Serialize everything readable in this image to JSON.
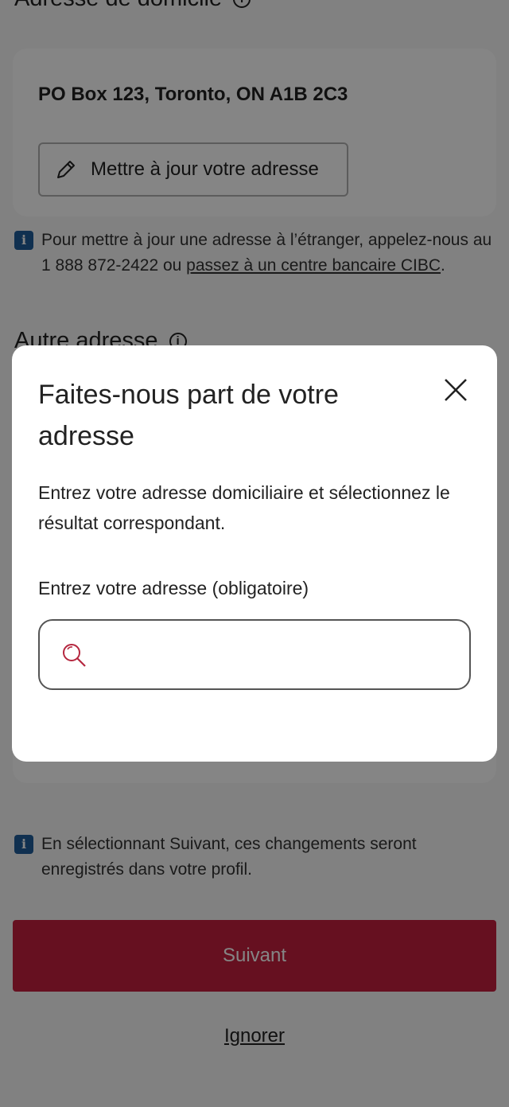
{
  "home_address": {
    "heading": "Adresse de domicile",
    "address": "PO Box 123, Toronto, ON A1B 2C3",
    "update_button": "Mettre à jour votre adresse"
  },
  "foreign_note": {
    "text": "Pour mettre à jour une adresse à l’étranger, appelez-nous au 1 888 872-2422 ou ",
    "link": "passez à un centre bancaire CIBC",
    "suffix": "."
  },
  "other_address": {
    "heading": "Autre adresse"
  },
  "save_note": {
    "text": "En sélectionnant Suivant, ces changements seront enregistrés dans votre profil."
  },
  "actions": {
    "next": "Suivant",
    "skip": "Ignorer"
  },
  "modal": {
    "title": "Faites-nous part de votre adresse",
    "description": "Entrez votre adresse domiciliaire et sélectionnez le résultat correspondant.",
    "field_label": "Entrez votre adresse (obligatoire)",
    "field_value": "",
    "icons": {
      "close": "close-icon",
      "search": "search-icon"
    }
  },
  "colors": {
    "brand_red": "#c41f3e",
    "info_blue": "#1f5c99",
    "search_icon": "#b5273f"
  }
}
